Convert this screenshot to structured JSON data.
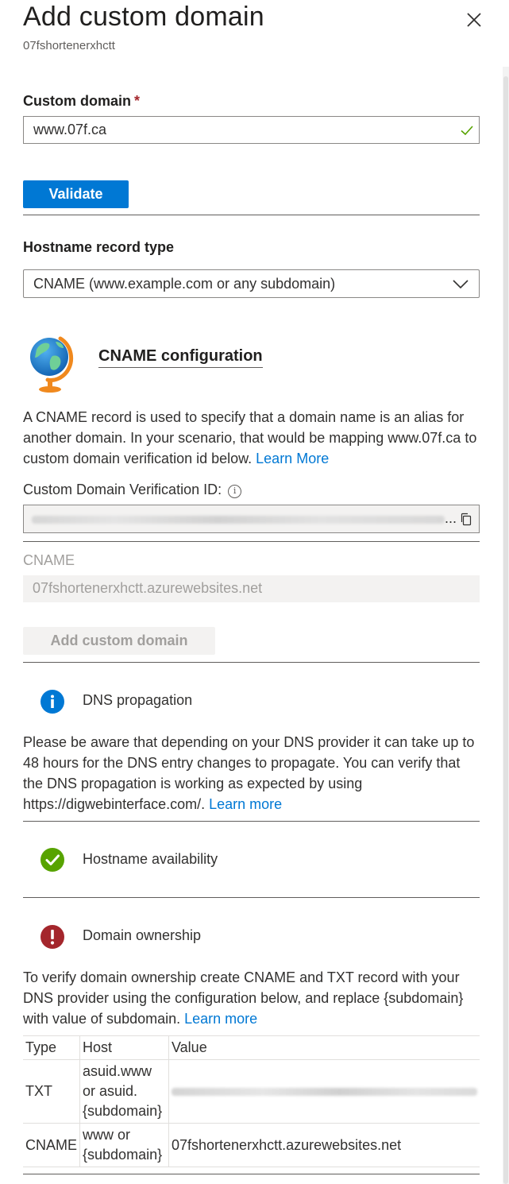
{
  "header": {
    "title": "Add custom domain",
    "subtitle": "07fshortenerxhctt"
  },
  "custom_domain": {
    "label": "Custom domain",
    "required_marker": "*",
    "value": "www.07f.ca"
  },
  "validate_button": "Validate",
  "record_type": {
    "label": "Hostname record type",
    "selected": "CNAME (www.example.com or any subdomain)"
  },
  "cname_config": {
    "title": "CNAME configuration",
    "description": "A CNAME record is used to specify that a domain name is an alias for another domain. In your scenario, that would be mapping www.07f.ca to custom domain verification id below.",
    "learn_more": "Learn More",
    "verification_label": "Custom Domain Verification ID:",
    "verification_ellipsis": "...",
    "cname_label": "CNAME",
    "cname_value": "07fshortenerxhctt.azurewebsites.net"
  },
  "add_button": "Add custom domain",
  "dns_propagation": {
    "title": "DNS propagation",
    "text": "Please be aware that depending on your DNS provider it can take up to 48 hours for the DNS entry changes to propagate. You can verify that the DNS propagation is working as expected by using https://digwebinterface.com/.",
    "learn_more": "Learn more"
  },
  "hostname_availability": {
    "title": "Hostname availability"
  },
  "domain_ownership": {
    "title": "Domain ownership",
    "text": "To verify domain ownership create CNAME and TXT record with your DNS provider using the configuration below, and replace {subdomain} with value of subdomain.",
    "learn_more": "Learn more"
  },
  "records_table": {
    "headers": [
      "Type",
      "Host",
      "Value"
    ],
    "rows": [
      {
        "type": "TXT",
        "host_line1": "asuid.www",
        "host_line2": "or asuid.",
        "host_line3": "{subdomain}",
        "value": ""
      },
      {
        "type": "CNAME",
        "host_line1": "www or",
        "host_line2": "{subdomain}",
        "value": "07fshortenerxhctt.azurewebsites.net"
      }
    ]
  },
  "colors": {
    "primary": "#0078d4",
    "success": "#57a300",
    "error": "#a4262c",
    "info": "#0078d4"
  },
  "icons": {
    "close": "close-icon",
    "valid": "checkmark-icon",
    "dropdown": "chevron-down-icon",
    "globe": "globe-icon",
    "info": "info-icon",
    "copy": "copy-icon",
    "success": "success-icon",
    "error": "error-icon"
  }
}
